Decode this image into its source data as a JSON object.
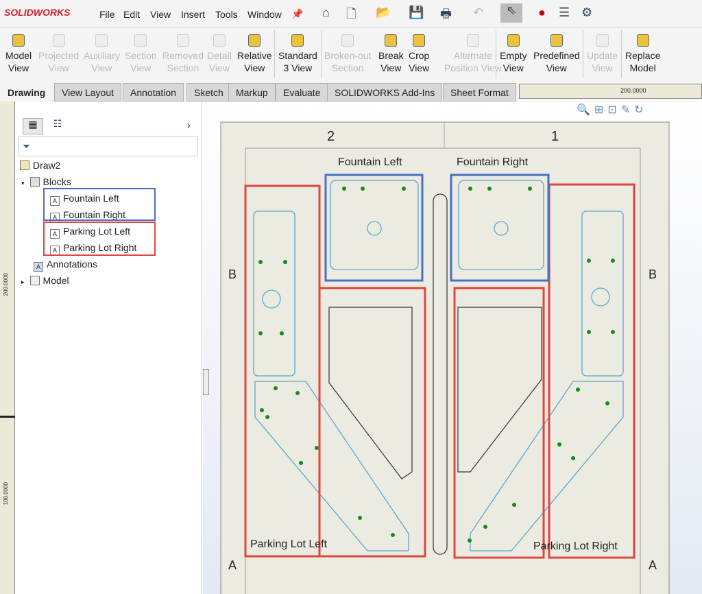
{
  "app": {
    "logo": "SOLIDWORKS"
  },
  "menu": [
    "File",
    "Edit",
    "View",
    "Insert",
    "Tools",
    "Window"
  ],
  "commands": [
    {
      "l1": "Model",
      "l2": "View",
      "enabled": true
    },
    {
      "l1": "Projected",
      "l2": "View",
      "enabled": false
    },
    {
      "l1": "Auxiliary",
      "l2": "View",
      "enabled": false
    },
    {
      "l1": "Section",
      "l2": "View",
      "enabled": false
    },
    {
      "l1": "Removed",
      "l2": "Section",
      "enabled": false
    },
    {
      "l1": "Detail",
      "l2": "View",
      "enabled": false
    },
    {
      "l1": "Relative",
      "l2": "View",
      "enabled": true
    },
    {
      "l1": "Standard",
      "l2": "3 View",
      "enabled": true
    },
    {
      "l1": "Broken-out",
      "l2": "Section",
      "enabled": false
    },
    {
      "l1": "Break",
      "l2": "View",
      "enabled": true
    },
    {
      "l1": "Crop",
      "l2": "View",
      "enabled": true
    },
    {
      "l1": "Alternate",
      "l2": "Position View",
      "enabled": false
    },
    {
      "l1": "Empty",
      "l2": "View",
      "enabled": true
    },
    {
      "l1": "Predefined",
      "l2": "View",
      "enabled": true
    },
    {
      "l1": "Update",
      "l2": "View",
      "enabled": false
    },
    {
      "l1": "Replace",
      "l2": "Model",
      "enabled": true
    }
  ],
  "tabs": [
    "Drawing",
    "View Layout",
    "Annotation",
    "Sketch",
    "Markup",
    "Evaluate",
    "SOLIDWORKS Add-Ins",
    "Sheet Format"
  ],
  "active_tab": "Drawing",
  "ruler": {
    "h_label": "200.0000",
    "v_labels": [
      "200.0000",
      "100.0000"
    ]
  },
  "tree": {
    "root": "Draw2",
    "blocks": "Blocks",
    "items": [
      "Fountain Left",
      "Fountain Right",
      "Parking Lot Left",
      "Parking Lot Right"
    ],
    "annotations": "Annotations",
    "model": "Model"
  },
  "sheet": {
    "zones_top": [
      "2",
      "1"
    ],
    "zones_side": [
      "B",
      "A"
    ],
    "labels": {
      "fountain_left": "Fountain Left",
      "fountain_right": "Fountain Right",
      "parking_left": "Parking Lot Left",
      "parking_right": "Parking Lot Right"
    }
  },
  "colors": {
    "highlight_blue": "#4a6fc4",
    "highlight_red": "#e0453f",
    "sheet": "#ebebe2",
    "line": "#5aa7c9",
    "tree_green": "#1a8a1a"
  }
}
